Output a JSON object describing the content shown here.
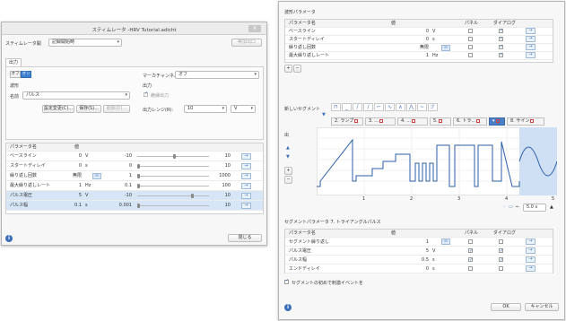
{
  "win1": {
    "title": "スティムレータ -HRV Tutorial.adicht",
    "stim_mode_label": "スティムレータ開",
    "stim_mode_value": "記録開始時",
    "help_label": "等加出口",
    "tab_output": "出力",
    "toggle_off": "オフ",
    "toggle_on": "オン",
    "waveform_label": "波形",
    "name_label": "名前",
    "name_value": "パルス",
    "btn_change": "設定変更(C)...",
    "btn_save": "保存(S)...",
    "btn_delete": "削除(D)...",
    "marker_channel_label": "マーカチャンネル",
    "marker_channel_value": "オフ",
    "output_label": "出力",
    "isolated_label": "絶縁出力",
    "output_range_label": "出力レンジ(R):",
    "output_range_value": "10",
    "output_unit": "V",
    "table_headers": [
      "パラメータ名",
      "値"
    ],
    "params": [
      {
        "name": "ベースライン",
        "value": "0",
        "unit": "V",
        "min": "-10",
        "max": "10"
      },
      {
        "name": "スタートディレイ",
        "value": "0",
        "unit": "s",
        "min": "0",
        "max": "10"
      },
      {
        "name": "繰り返し回数",
        "value": "無限",
        "unit": "",
        "min": "1",
        "max": "1000"
      },
      {
        "name": "最大繰り返しレート",
        "value": "1",
        "unit": "Hz",
        "min": "0.1",
        "max": "100"
      },
      {
        "name": "パルス電圧",
        "value": "5",
        "unit": "V",
        "min": "-10",
        "max": "10"
      },
      {
        "name": "パルス幅",
        "value": "0.1",
        "unit": "s",
        "min": "0.001",
        "max": "10"
      }
    ],
    "inf_symbol": "∞",
    "arrow_symbol": "→",
    "close_button": "閉じる",
    "info_icon": "i"
  },
  "win2": {
    "top_section_title": "波形パラメータ",
    "top_headers": [
      "パラメータ名",
      "値",
      "パネル",
      "ダイアログ"
    ],
    "top_params": [
      {
        "name": "ベースライン",
        "value": "0",
        "unit": "V",
        "panel": false,
        "dialog": true
      },
      {
        "name": "スタートディレイ",
        "value": "0",
        "unit": "s",
        "panel": false,
        "dialog": true
      },
      {
        "name": "繰り返し回数",
        "value": "無限",
        "unit": "",
        "panel": false,
        "dialog": true
      },
      {
        "name": "最大繰り返しレート",
        "value": "1",
        "unit": "Hz",
        "panel": false,
        "dialog": true
      }
    ],
    "add_symbol": "+",
    "remove_symbol": "−",
    "new_segment_label": "新しいセグメント",
    "segment_tabs": [
      "2. ランプ",
      "3. ...",
      "4. ...",
      "5.",
      "6. トラ...",
      "",
      "8. サイン"
    ],
    "graph_y_label_top": "出",
    "graph_ticks_x": [
      "1",
      "2",
      "3",
      "4",
      "5"
    ],
    "zoom_value": "5.0",
    "zoom_unit": "s",
    "seg_section_title": "セグメントパラメータ 7. トライアングルパルス",
    "seg_headers": [
      "パラメータ名",
      "値",
      "パネル",
      "ダイアログ"
    ],
    "seg_params": [
      {
        "name": "セグメント繰り返し",
        "value": "1",
        "unit": "",
        "panel": false,
        "dialog": false
      },
      {
        "name": "パルス電圧",
        "value": "5",
        "unit": "V",
        "panel": true,
        "dialog": true
      },
      {
        "name": "パルス幅",
        "value": "0.5",
        "unit": "s",
        "panel": true,
        "dialog": true
      },
      {
        "name": "エンドディレイ",
        "value": "0",
        "unit": "s",
        "panel": false,
        "dialog": false
      }
    ],
    "event_checkbox_label": "セグメントの初めで刺激イベントを",
    "ok_button": "OK",
    "cancel_button": "キャンセル",
    "info_icon": "i"
  },
  "colors": {
    "accent": "#3d7fd0",
    "selected_row": "#d6e6f7",
    "wave": "#2b5fa8"
  }
}
